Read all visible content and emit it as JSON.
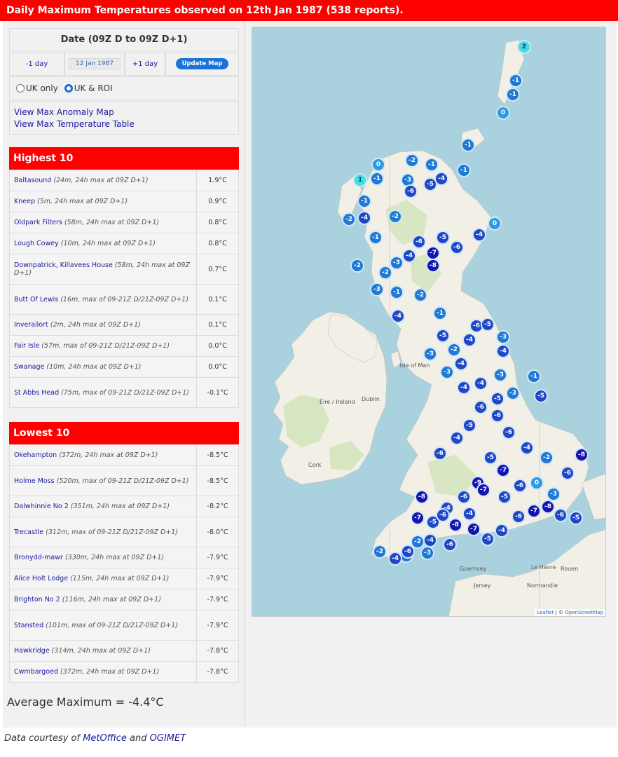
{
  "banner": "Daily Maximum Temperatures observed on 12th Jan 1987 (538 reports).",
  "date_panel": {
    "title": "Date (09Z D to 09Z D+1)",
    "prev_label": "-1 day",
    "date_value": "12 Jan 1987",
    "next_label": "+1 day",
    "update_label": "Update Map"
  },
  "region": {
    "option1": "UK only",
    "option2": "UK & ROI",
    "selected": "UK & ROI"
  },
  "links": {
    "anomaly": "View Max Anomaly Map",
    "table": "View Max Temperature Table"
  },
  "highest": {
    "title": "Highest 10",
    "rows": [
      {
        "station": "Baltasound",
        "detail": " (24m, 24h max at 09Z D+1)",
        "value": "1.9°C"
      },
      {
        "station": "Kneep",
        "detail": " (5m, 24h max at 09Z D+1)",
        "value": "0.9°C"
      },
      {
        "station": "Oldpark Filters",
        "detail": " (58m, 24h max at 09Z D+1)",
        "value": "0.8°C"
      },
      {
        "station": "Lough Cowey",
        "detail": " (10m, 24h max at 09Z D+1)",
        "value": "0.8°C"
      },
      {
        "station": "Downpatrick, Killavees House",
        "detail": " (58m, 24h max at 09Z D+1)",
        "value": "0.7°C"
      },
      {
        "station": "Butt Of Lewis",
        "detail": " (16m, max of 09-21Z D/21Z-09Z D+1)",
        "value": "0.1°C"
      },
      {
        "station": "Inverailort",
        "detail": " (2m, 24h max at 09Z D+1)",
        "value": "0.1°C"
      },
      {
        "station": "Fair Isle",
        "detail": " (57m, max of 09-21Z D/21Z-09Z D+1)",
        "value": "0.0°C"
      },
      {
        "station": "Swanage",
        "detail": " (10m, 24h max at 09Z D+1)",
        "value": "0.0°C"
      },
      {
        "station": "St Abbs Head",
        "detail": " (75m, max of 09-21Z D/21Z-09Z D+1)",
        "value": "-0.1°C"
      }
    ]
  },
  "lowest": {
    "title": "Lowest 10",
    "rows": [
      {
        "station": "Okehampton",
        "detail": " (372m, 24h max at 09Z D+1)",
        "value": "-8.5°C"
      },
      {
        "station": "Holme Moss",
        "detail": " (520m, max of 09-21Z D/21Z-09Z D+1)",
        "value": "-8.5°C"
      },
      {
        "station": "Dalwhinnie No 2",
        "detail": " (351m, 24h max at 09Z D+1)",
        "value": "-8.2°C"
      },
      {
        "station": "Trecastle",
        "detail": " (312m, max of 09-21Z D/21Z-09Z D+1)",
        "value": "-8.0°C"
      },
      {
        "station": "Bronydd-mawr",
        "detail": " (330m, 24h max at 09Z D+1)",
        "value": "-7.9°C"
      },
      {
        "station": "Alice Holt Lodge",
        "detail": " (115m, 24h max at 09Z D+1)",
        "value": "-7.9°C"
      },
      {
        "station": "Brighton No 2",
        "detail": " (116m, 24h max at 09Z D+1)",
        "value": "-7.9°C"
      },
      {
        "station": "Stansted",
        "detail": " (101m, max of 09-21Z D/21Z-09Z D+1)",
        "value": "-7.9°C"
      },
      {
        "station": "Hawkridge",
        "detail": " (314m, 24h max at 09Z D+1)",
        "value": "-7.8°C"
      },
      {
        "station": "Cwmbargoed",
        "detail": " (372m, 24h max at 09Z D+1)",
        "value": "-7.8°C"
      }
    ]
  },
  "average": "Average Maximum = -4.4°C",
  "map": {
    "attribution_leaflet": "Leaflet",
    "attribution_sep": " | © ",
    "attribution_osm": "OpenStreetMap",
    "place_labels": [
      "Isle of Man",
      "Éire / Ireland",
      "Dublin",
      "Cork",
      "Guernsey",
      "Jersey",
      "Rouen",
      "Le Havre",
      "Normandie"
    ],
    "marker_colors": {
      "warm": "#3de0e6",
      "zero": "#2e9be0",
      "mild": "#1e78d4",
      "cold": "#1f47c8",
      "severe": "#1414b0"
    },
    "marker_values": [
      "2",
      "-1",
      "-1",
      "0",
      "-1",
      "0",
      "-2",
      "-1",
      "-1",
      "1",
      "-1",
      "-3",
      "-6",
      "-5",
      "-4",
      "-1",
      "-2",
      "-4",
      "-2",
      "-1",
      "-2",
      "-6",
      "-5",
      "-7",
      "-4",
      "-3",
      "-2",
      "-1",
      "-8",
      "-6",
      "-4",
      "0",
      "-3",
      "-4",
      "-2",
      "-1",
      "-5",
      "-3",
      "-2",
      "-4",
      "-3",
      "-4",
      "-6",
      "-5",
      "-3",
      "-4",
      "-4",
      "-6",
      "-5",
      "-3",
      "-1",
      "-5",
      "-3",
      "-4",
      "-6",
      "-5",
      "-4",
      "-6",
      "-5",
      "-7",
      "-9",
      "-6",
      "-4",
      "-5",
      "-2",
      "-3",
      "-4",
      "-6",
      "-7",
      "-5",
      "-4",
      "-6",
      "-7",
      "-8",
      "-6",
      "-5",
      "-7",
      "-8",
      "-2",
      "-4",
      "-6",
      "-3",
      "-6",
      "-8",
      "-4",
      "-7",
      "-5",
      "-6",
      "0",
      "-3",
      "-6",
      "-8",
      "-2",
      "-4",
      "-6"
    ]
  },
  "footer": {
    "prefix": "Data courtesy of ",
    "source1": "MetOffice",
    "and": " and ",
    "source2": "OGIMET"
  }
}
